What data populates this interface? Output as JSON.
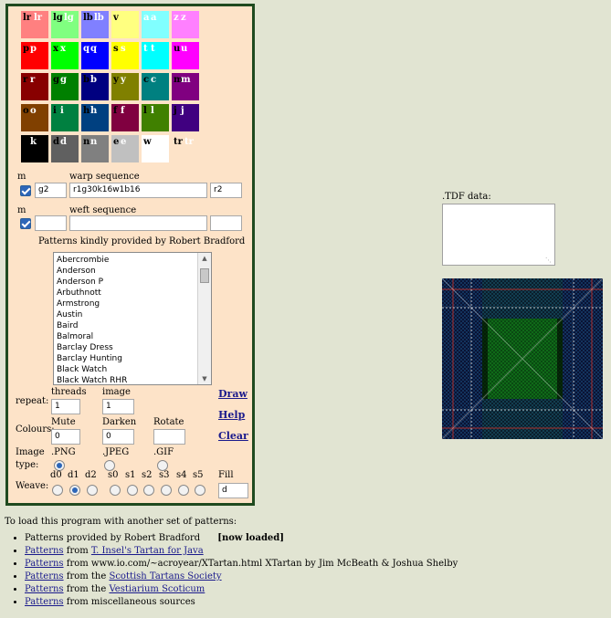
{
  "swatches": [
    {
      "k1": "lr",
      "k2": "lr",
      "bg": "#ff8080",
      "c1": "#000",
      "c2": "#fff"
    },
    {
      "k1": "lg",
      "k2": "lg",
      "bg": "#80ff80",
      "c1": "#000",
      "c2": "#fff"
    },
    {
      "k1": "lb",
      "k2": "lb",
      "bg": "#8080ff",
      "c1": "#000",
      "c2": "#fff"
    },
    {
      "k1": "v",
      "k2": "",
      "bg": "#ffff80",
      "c1": "#000",
      "c2": "#fff"
    },
    {
      "k1": "a",
      "k2": "a",
      "bg": "#80ffff",
      "c1": "#fff",
      "c2": "#fff"
    },
    {
      "k1": "z",
      "k2": "z",
      "bg": "#ff80ff",
      "c1": "#fff",
      "c2": "#fff"
    },
    {
      "k1": "p",
      "k2": "p",
      "bg": "#ff0000",
      "c1": "#000",
      "c2": "#fff"
    },
    {
      "k1": "x",
      "k2": "x",
      "bg": "#00ff00",
      "c1": "#000",
      "c2": "#fff"
    },
    {
      "k1": "q",
      "k2": "q",
      "bg": "#0000ff",
      "c1": "#fff",
      "c2": "#fff"
    },
    {
      "k1": "s",
      "k2": "s",
      "bg": "#ffff00",
      "c1": "#000",
      "c2": "#fff"
    },
    {
      "k1": "t",
      "k2": "t",
      "bg": "#00ffff",
      "c1": "#fff",
      "c2": "#fff"
    },
    {
      "k1": "u",
      "k2": "u",
      "bg": "#ff00ff",
      "c1": "#000",
      "c2": "#fff"
    },
    {
      "k1": "r",
      "k2": "r",
      "bg": "#880000",
      "c1": "#000",
      "c2": "#fff"
    },
    {
      "k1": "g",
      "k2": "g",
      "bg": "#008000",
      "c1": "#000",
      "c2": "#fff"
    },
    {
      "k1": "b",
      "k2": "b",
      "bg": "#000080",
      "c1": "#000",
      "c2": "#fff"
    },
    {
      "k1": "y",
      "k2": "y",
      "bg": "#808000",
      "c1": "#000",
      "c2": "#fff"
    },
    {
      "k1": "c",
      "k2": "c",
      "bg": "#008080",
      "c1": "#000",
      "c2": "#fff"
    },
    {
      "k1": "m",
      "k2": "m",
      "bg": "#800080",
      "c1": "#000",
      "c2": "#fff"
    },
    {
      "k1": "o",
      "k2": "o",
      "bg": "#804000",
      "c1": "#000",
      "c2": "#fff"
    },
    {
      "k1": "i",
      "k2": "i",
      "bg": "#008040",
      "c1": "#000",
      "c2": "#fff"
    },
    {
      "k1": "h",
      "k2": "h",
      "bg": "#004080",
      "c1": "#000",
      "c2": "#fff"
    },
    {
      "k1": "f",
      "k2": "f",
      "bg": "#800040",
      "c1": "#000",
      "c2": "#fff"
    },
    {
      "k1": "l",
      "k2": "l",
      "bg": "#408000",
      "c1": "#000",
      "c2": "#fff"
    },
    {
      "k1": "j",
      "k2": "j",
      "bg": "#400080",
      "c1": "#000",
      "c2": "#fff"
    },
    {
      "k1": "k",
      "k2": "k",
      "bg": "#000000",
      "c1": "#000",
      "c2": "#fff"
    },
    {
      "k1": "d",
      "k2": "d",
      "bg": "#606060",
      "c1": "#000",
      "c2": "#fff"
    },
    {
      "k1": "n",
      "k2": "n",
      "bg": "#808080",
      "c1": "#000",
      "c2": "#fff"
    },
    {
      "k1": "e",
      "k2": "e",
      "bg": "#c0c0c0",
      "c1": "#000",
      "c2": "#fff"
    },
    {
      "k1": "w",
      "k2": "",
      "bg": "#ffffff",
      "c1": "#000",
      "c2": "#fff"
    },
    {
      "k1": "tr",
      "k2": "tr",
      "bg": "",
      "c1": "#000",
      "c2": "#fff"
    }
  ],
  "warp": {
    "m_label": "m",
    "label": "warp sequence",
    "prefix": "g2",
    "sequence": "r1g30k16w1b16",
    "suffix": "r2"
  },
  "weft": {
    "m_label": "m",
    "label": "weft sequence",
    "prefix": "",
    "sequence": "",
    "suffix": ""
  },
  "patterns_heading": "Patterns kindly provided by Robert Bradford",
  "patterns": [
    "Abercrombie",
    "Anderson",
    "Anderson P",
    "Arbuthnott",
    "Armstrong",
    "Austin",
    "Baird",
    "Balmoral",
    "Barclay Dress",
    "Barclay Hunting",
    "Black Watch",
    "Black Watch RHR"
  ],
  "repeat": {
    "label": "repeat:",
    "threads_label": "threads",
    "threads_value": "1",
    "image_label": "image",
    "image_value": "1"
  },
  "colours": {
    "label": "Colours:",
    "mute_label": "Mute",
    "mute_value": "0",
    "darken_label": "Darken",
    "darken_value": "0",
    "rotate_label": "Rotate",
    "rotate_value": ""
  },
  "image_type": {
    "label_1": "Image",
    "label_2": "type:",
    "options": [
      ".PNG",
      ".JPEG",
      ".GIF"
    ],
    "selected": ".PNG"
  },
  "weave": {
    "label": "Weave:",
    "options": [
      "d0",
      "d1",
      "d2",
      "s0",
      "s1",
      "s2",
      "s3",
      "s4",
      "s5"
    ],
    "selected": "d1"
  },
  "fill": {
    "label": "Fill",
    "value": "d"
  },
  "commands": {
    "draw": "Draw",
    "help": "Help",
    "clear": "Clear"
  },
  "tdf_label": ".TDF data:",
  "footer": {
    "intro": "To load this program with another set of patterns:",
    "items": [
      {
        "link": "",
        "text_1": "Patterns provided by Robert Bradford",
        "link_2": "",
        "text_2": "",
        "bold": "[now loaded]"
      },
      {
        "link": "Patterns",
        "text_1": " from ",
        "link_2": "T. Insel's Tartan for Java",
        "text_2": "",
        "bold": ""
      },
      {
        "link": "Patterns",
        "text_1": " from www.io.com/~acroyear/XTartan.html XTartan by Jim McBeath & Joshua Shelby",
        "link_2": "",
        "text_2": "",
        "bold": ""
      },
      {
        "link": "Patterns",
        "text_1": " from the ",
        "link_2": "Scottish Tartans Society",
        "text_2": "",
        "bold": ""
      },
      {
        "link": "Patterns",
        "text_1": " from the ",
        "link_2": "Vestiarium Scoticum",
        "text_2": "",
        "bold": ""
      },
      {
        "link": "Patterns",
        "text_1": " from miscellaneous sources",
        "link_2": "",
        "text_2": "",
        "bold": ""
      }
    ]
  }
}
